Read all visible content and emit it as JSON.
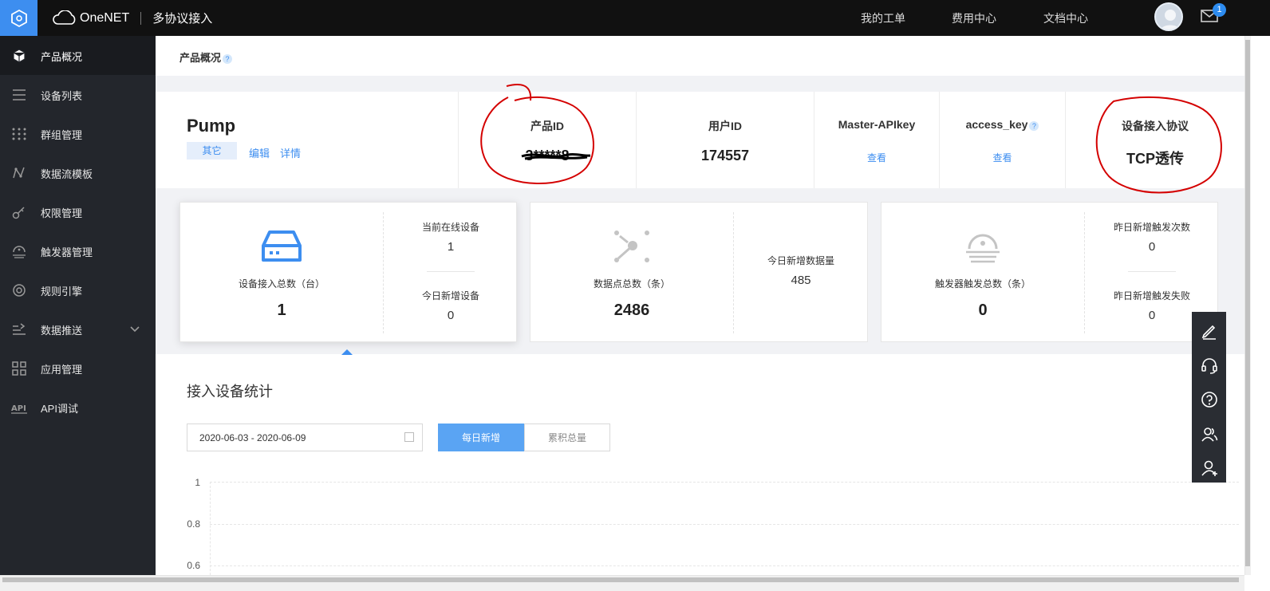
{
  "topbar": {
    "brand": "OneNET",
    "section": "多协议接入",
    "nav": [
      "我的工单",
      "费用中心",
      "文档中心"
    ],
    "mail_badge": "1"
  },
  "sidebar": {
    "items": [
      {
        "label": "产品概况",
        "icon": "cube-icon",
        "active": true
      },
      {
        "label": "设备列表",
        "icon": "list-icon"
      },
      {
        "label": "群组管理",
        "icon": "grid-dots-icon"
      },
      {
        "label": "数据流模板",
        "icon": "dataflow-icon"
      },
      {
        "label": "权限管理",
        "icon": "key-icon"
      },
      {
        "label": "触发器管理",
        "icon": "trigger-icon"
      },
      {
        "label": "规则引擎",
        "icon": "rule-engine-icon"
      },
      {
        "label": "数据推送",
        "icon": "data-push-icon",
        "expandable": true
      },
      {
        "label": "应用管理",
        "icon": "apps-icon"
      },
      {
        "label": "API调试",
        "icon": "api-icon"
      }
    ]
  },
  "breadcrumb": {
    "title": "产品概况",
    "help": "?"
  },
  "product": {
    "name": "Pump",
    "tag": "其它",
    "edit_link": "编辑",
    "detail_link": "详情",
    "product_id_label": "产品ID",
    "product_id_value": "3*****8",
    "user_id_label": "用户ID",
    "user_id_value": "174557",
    "master_apikey_label": "Master-APIkey",
    "master_apikey_action": "查看",
    "access_key_label": "access_key",
    "access_key_action": "查看",
    "protocol_label": "设备接入协议",
    "protocol_value": "TCP透传"
  },
  "cards": {
    "devices": {
      "label": "设备接入总数（台）",
      "value": "1",
      "online_label": "当前在线设备",
      "online_value": "1",
      "new_today_label": "今日新增设备",
      "new_today_value": "0"
    },
    "datapoints": {
      "label": "数据点总数（条）",
      "value": "2486",
      "new_today_label": "今日新增数据量",
      "new_today_value": "485"
    },
    "triggers": {
      "label": "触发器触发总数（条）",
      "value": "0",
      "yesterday_label": "昨日新增触发次数",
      "yesterday_value": "0",
      "fail_label": "昨日新增触发失败",
      "fail_value": "0"
    }
  },
  "stats": {
    "title": "接入设备统计",
    "date_range": "2020-06-03 - 2020-06-09",
    "toggle_daily": "每日新增",
    "toggle_total": "累积总量",
    "y_ticks": [
      "1",
      "0.8",
      "0.6"
    ]
  },
  "colors": {
    "accent": "#3d8ef0",
    "sidebar": "#23262c",
    "topbar": "#111111",
    "annotation": "#d40000"
  }
}
